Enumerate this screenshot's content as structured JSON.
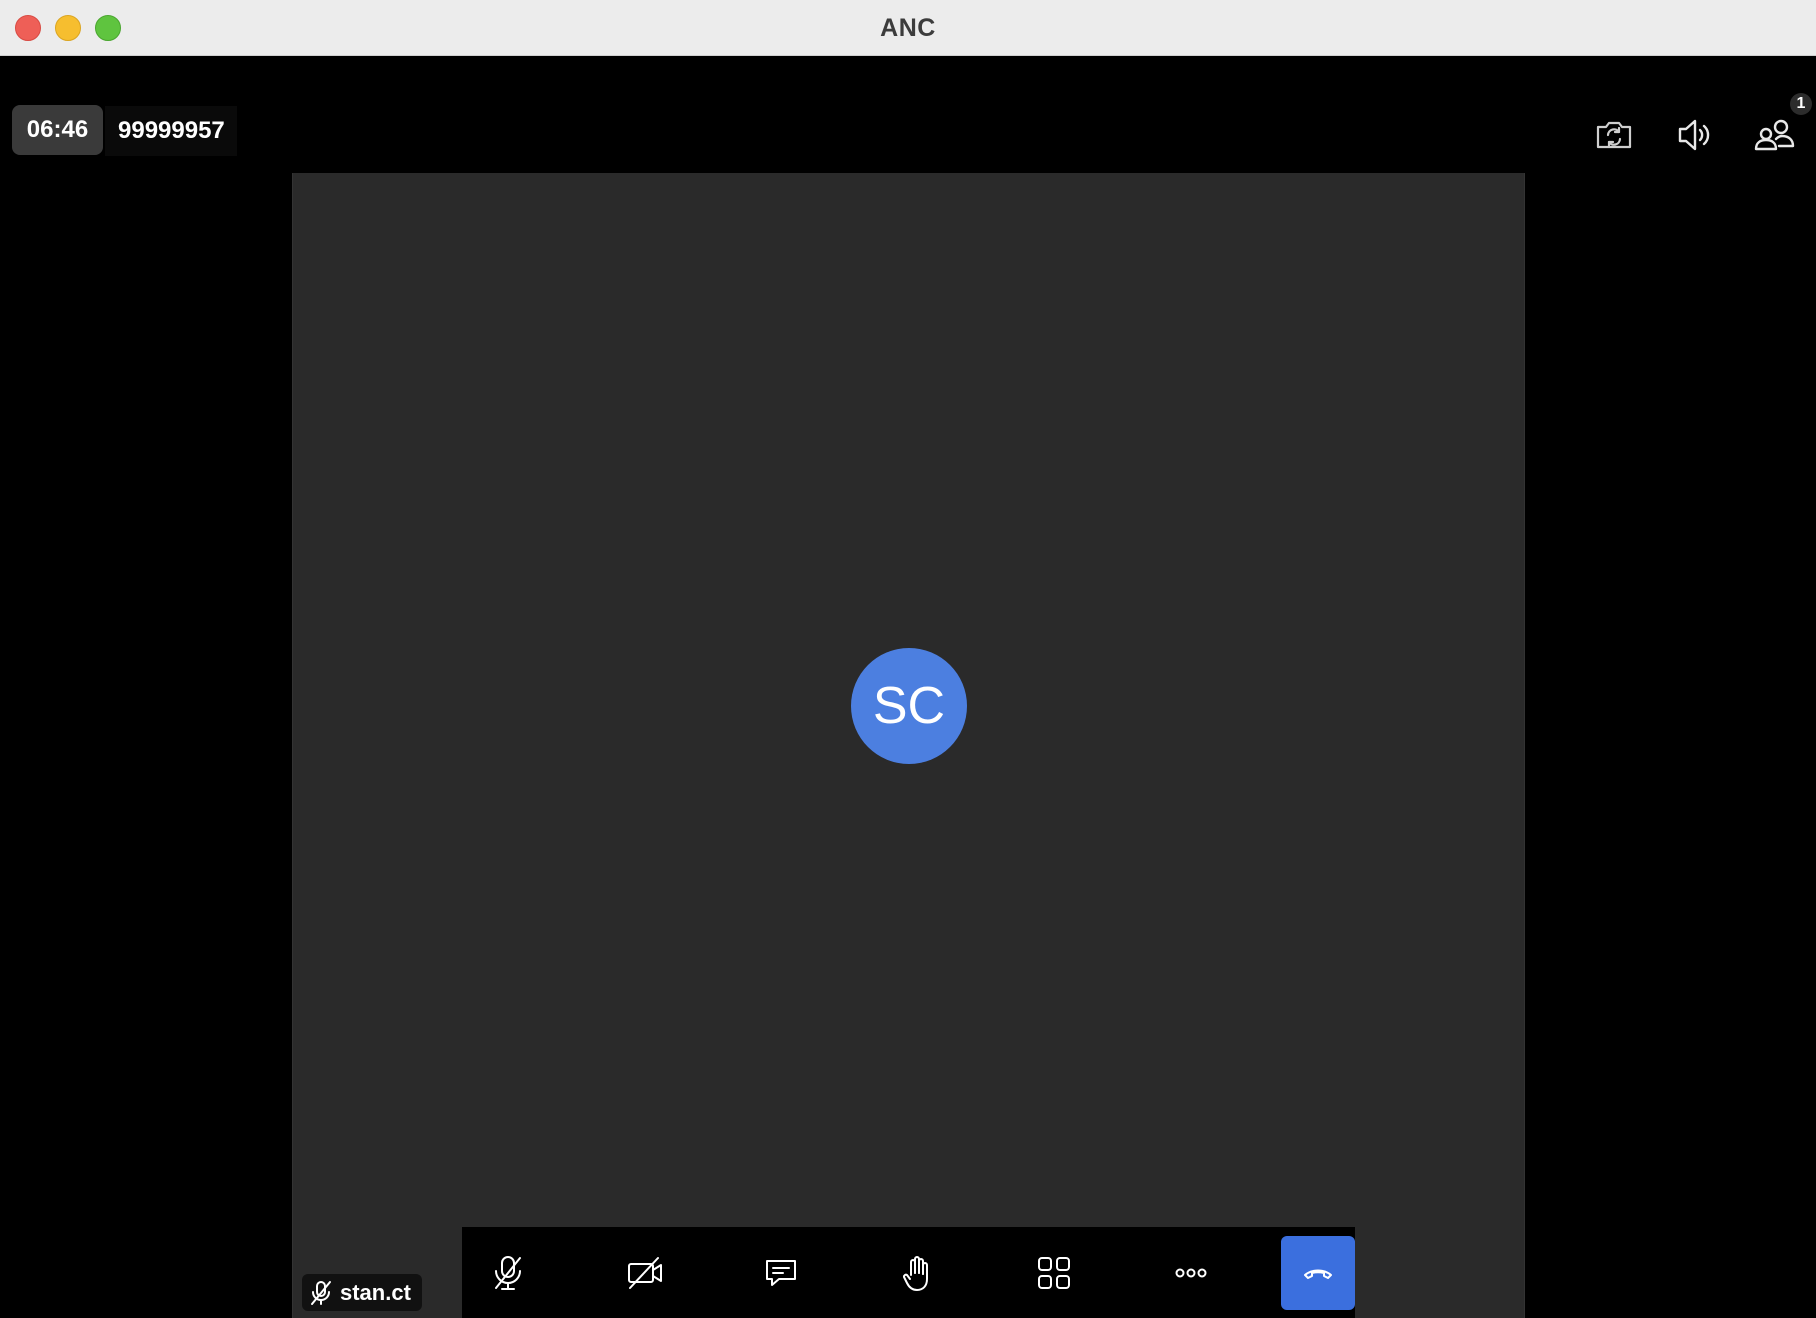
{
  "window": {
    "title": "ANC"
  },
  "header": {
    "timer": "06:46",
    "meeting_id": "99999957",
    "icons": [
      "switch-camera-icon",
      "speaker-icon",
      "participants-icon"
    ],
    "participants_count": "1"
  },
  "stage": {
    "avatar_initials": "SC",
    "avatar_color": "#4c7fe0",
    "background_color": "#2a2a2a"
  },
  "self_tag": {
    "name": "stan.ct",
    "mic_state": "muted"
  },
  "toolbar": {
    "buttons": [
      {
        "name": "mute-microphone",
        "icon": "microphone-off-icon"
      },
      {
        "name": "toggle-camera",
        "icon": "video-off-icon"
      },
      {
        "name": "chat",
        "icon": "chat-icon"
      },
      {
        "name": "raise-hand",
        "icon": "hand-icon"
      },
      {
        "name": "layout",
        "icon": "grid-icon"
      },
      {
        "name": "more",
        "icon": "more-icon"
      },
      {
        "name": "end-call",
        "icon": "hang-up-icon"
      }
    ],
    "end_call_color": "#3b6fde"
  }
}
